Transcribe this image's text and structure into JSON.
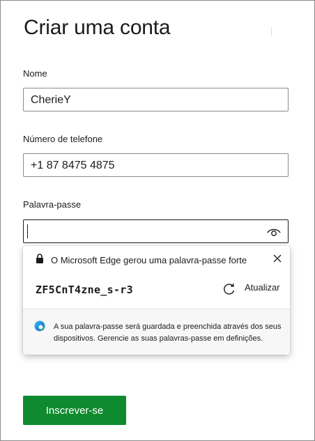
{
  "page": {
    "title": "Criar uma conta"
  },
  "fields": {
    "name": {
      "label": "Nome",
      "value": "CherieY"
    },
    "phone": {
      "label": "Número de telefone",
      "value": "+1 87 8475 4875"
    },
    "password": {
      "label": "Palavra-passe",
      "value": ""
    }
  },
  "popup": {
    "headline": "O Microsoft Edge gerou uma palavra-passe forte",
    "generated_password": "ZF5CnT4zne_s-r3",
    "refresh_label": "Atualizar",
    "info": "A sua palavra-passe será guardada e preenchida através dos seus dispositivos. Gerencie as suas palavras-passe em definições.",
    "icons": {
      "lock": "lock-icon",
      "close": "close-icon",
      "refresh": "refresh-icon",
      "edge": "edge-icon"
    }
  },
  "submit": {
    "label": "Inscrever-se"
  },
  "colors": {
    "accent": "#0f8a2e",
    "text": "#1b1b1b",
    "border": "#8a8a8a"
  }
}
